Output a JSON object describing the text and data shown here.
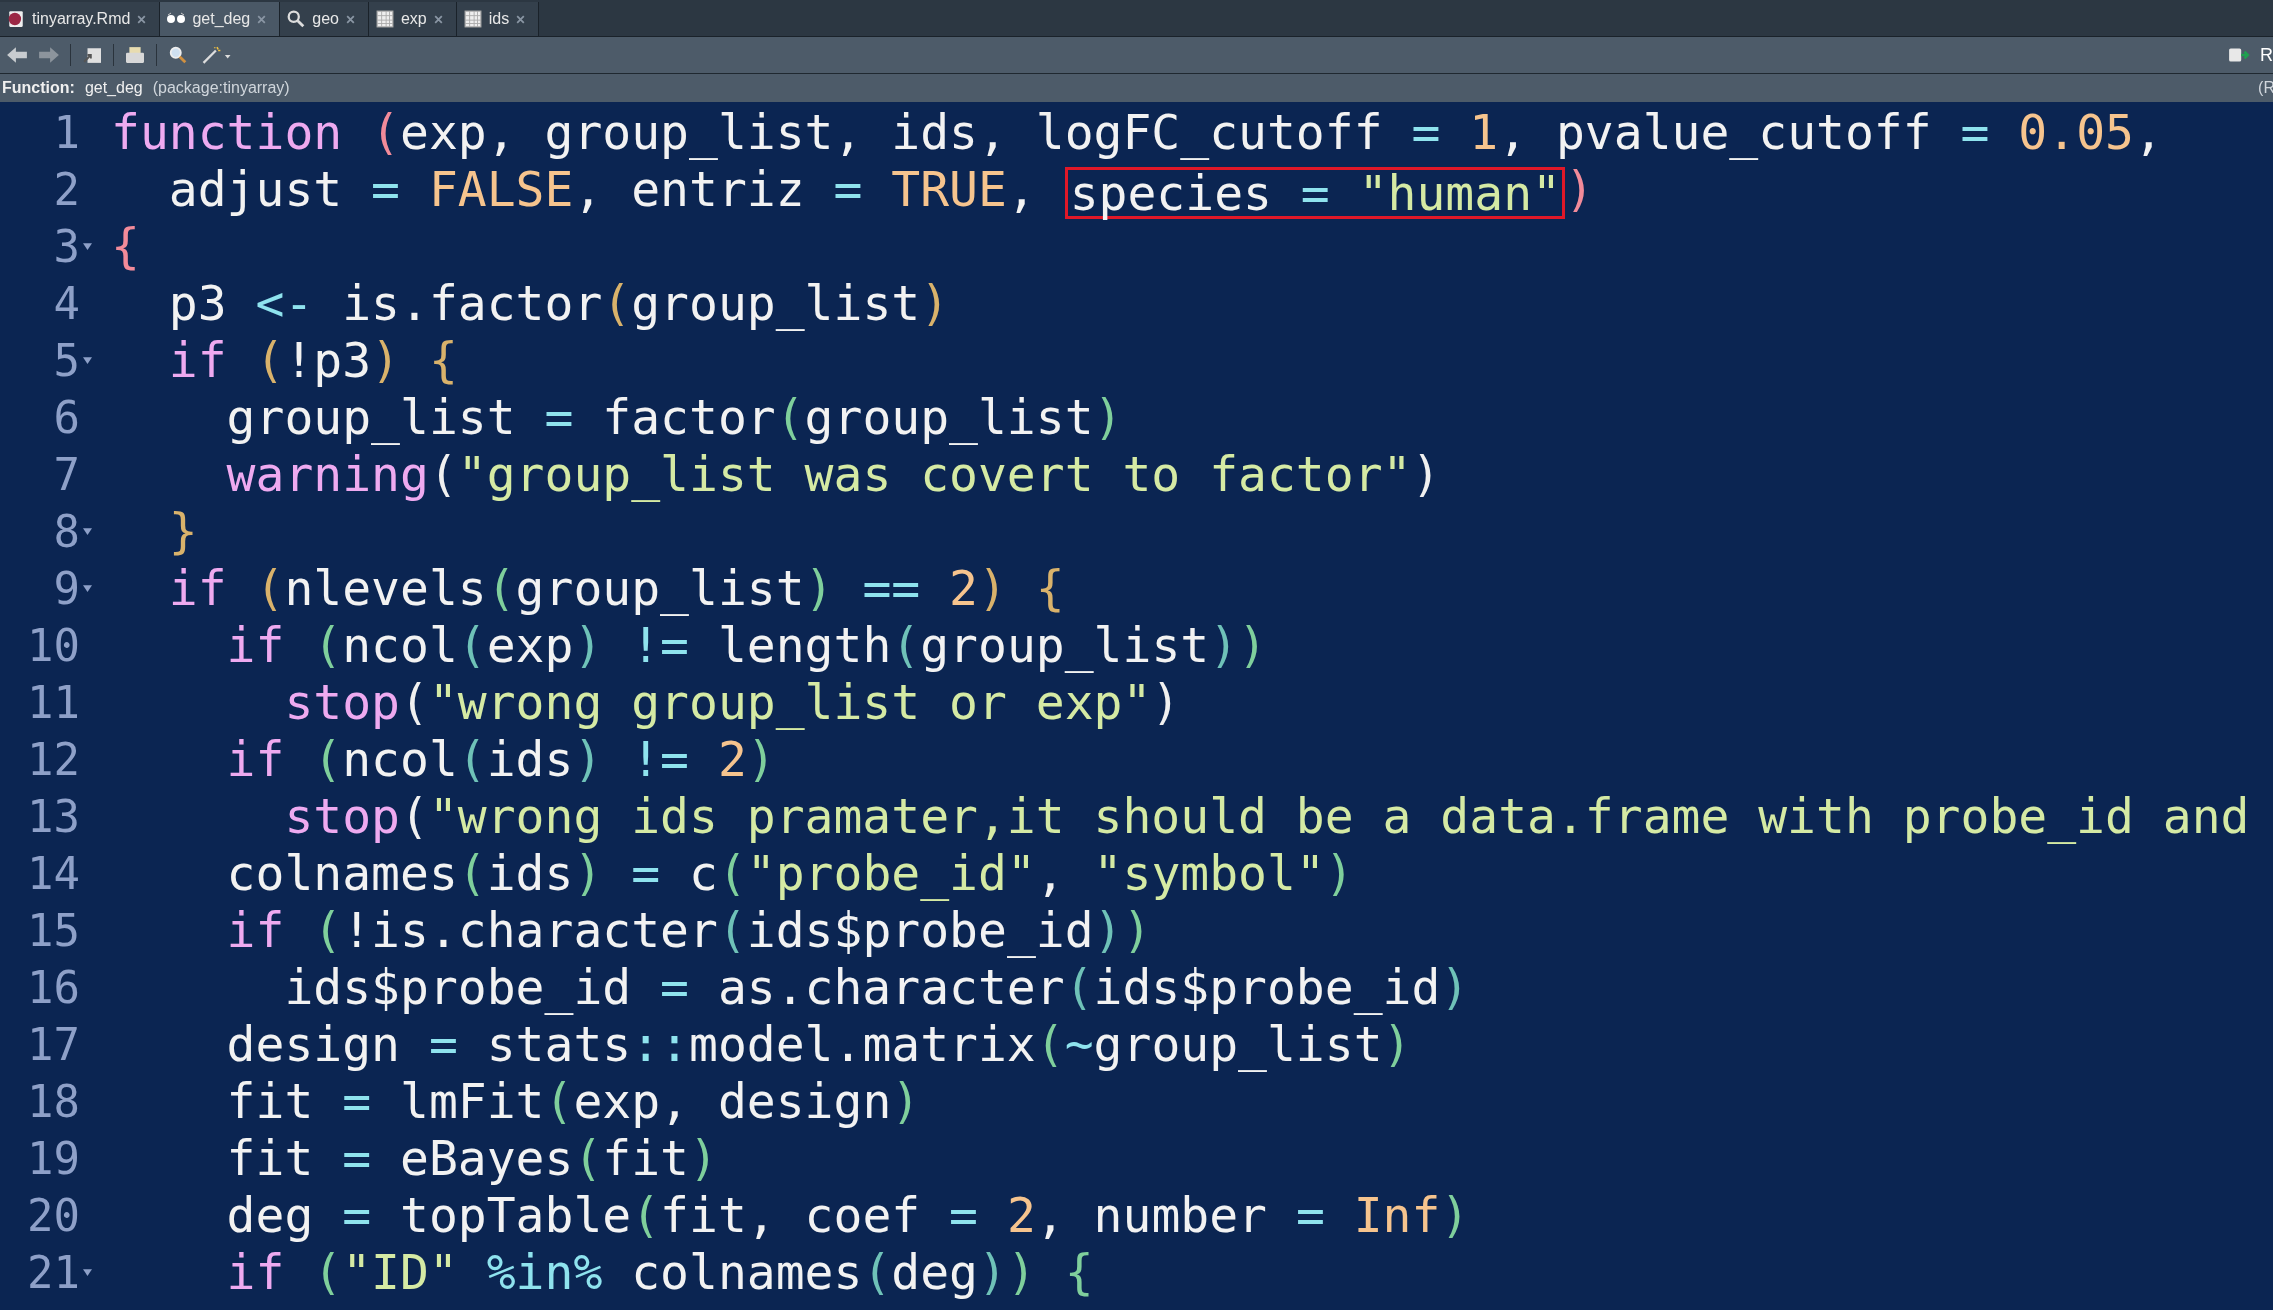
{
  "tabs": [
    {
      "label": "tinyarray.Rmd",
      "kind": "document",
      "selected": false
    },
    {
      "label": "get_deg",
      "kind": "function",
      "selected": true
    },
    {
      "label": "geo",
      "kind": "search",
      "selected": false
    },
    {
      "label": "exp",
      "kind": "table",
      "selected": false
    },
    {
      "label": "ids",
      "kind": "table",
      "selected": false
    }
  ],
  "toolbar": {
    "run_label": "R"
  },
  "function_bar": {
    "label": "Function:",
    "name": "get_deg",
    "package": "(package:tinyarray)",
    "right_text": "(R"
  },
  "lines": [
    {
      "number": "1",
      "fold": false,
      "tokens": [
        {
          "kind": "kw",
          "text": "function "
        },
        {
          "kind": "br",
          "text": "(",
          "color": "#f28b9a"
        },
        {
          "kind": "tx",
          "text": "exp, group_list, ids, logFC_cutoff"
        },
        {
          "kind": "op",
          "text": " = "
        },
        {
          "kind": "nu",
          "text": "1"
        },
        {
          "kind": "tx",
          "text": ", pvalue_cutoff"
        },
        {
          "kind": "op",
          "text": " = "
        },
        {
          "kind": "nu",
          "text": "0.05"
        },
        {
          "kind": "tx",
          "text": ","
        }
      ]
    },
    {
      "number": "2",
      "fold": false,
      "tokens": [
        {
          "kind": "tx",
          "text": "  adjust"
        },
        {
          "kind": "op",
          "text": " = "
        },
        {
          "kind": "nu",
          "text": "FALSE"
        },
        {
          "kind": "tx",
          "text": ", entriz"
        },
        {
          "kind": "op",
          "text": " = "
        },
        {
          "kind": "nu",
          "text": "TRUE"
        },
        {
          "kind": "tx",
          "text": ", "
        },
        {
          "kind": "box",
          "tokens": [
            {
              "kind": "tx",
              "text": "species"
            },
            {
              "kind": "op",
              "text": " = "
            },
            {
              "kind": "st",
              "text": "\"human\""
            }
          ]
        },
        {
          "kind": "br",
          "text": ")",
          "color": "#f28b9a"
        }
      ]
    },
    {
      "number": "3",
      "fold": true,
      "tokens": [
        {
          "kind": "br",
          "text": "{",
          "color": "#f28b9a"
        }
      ]
    },
    {
      "number": "4",
      "fold": false,
      "tokens": [
        {
          "kind": "tx",
          "text": "  p3 "
        },
        {
          "kind": "op",
          "text": "<- "
        },
        {
          "kind": "tx",
          "text": "is.factor"
        },
        {
          "kind": "br",
          "text": "(",
          "color": "#d9b26b"
        },
        {
          "kind": "tx",
          "text": "group_list"
        },
        {
          "kind": "br",
          "text": ")",
          "color": "#d9b26b"
        }
      ]
    },
    {
      "number": "5",
      "fold": true,
      "tokens": [
        {
          "kind": "kw",
          "text": "  if "
        },
        {
          "kind": "br",
          "text": "(",
          "color": "#d9b26b"
        },
        {
          "kind": "tx",
          "text": "!p3"
        },
        {
          "kind": "br",
          "text": ") {",
          "color": "#d9b26b"
        }
      ]
    },
    {
      "number": "6",
      "fold": false,
      "tokens": [
        {
          "kind": "tx",
          "text": "    group_list"
        },
        {
          "kind": "op",
          "text": " = "
        },
        {
          "kind": "tx",
          "text": "factor"
        },
        {
          "kind": "br",
          "text": "(",
          "color": "#7fcf9c"
        },
        {
          "kind": "tx",
          "text": "group_list"
        },
        {
          "kind": "br",
          "text": ")",
          "color": "#7fcf9c"
        }
      ]
    },
    {
      "number": "7",
      "fold": false,
      "tokens": [
        {
          "kind": "kw",
          "text": "    warning"
        },
        {
          "kind": "br",
          "text": "(",
          "color": "#f0f0f0"
        },
        {
          "kind": "st",
          "text": "\"group_list was covert to factor\""
        },
        {
          "kind": "br",
          "text": ")",
          "color": "#f0f0f0"
        }
      ]
    },
    {
      "number": "8",
      "fold": true,
      "tokens": [
        {
          "kind": "br",
          "text": "  }",
          "color": "#d9b26b"
        }
      ]
    },
    {
      "number": "9",
      "fold": true,
      "tokens": [
        {
          "kind": "kw",
          "text": "  if "
        },
        {
          "kind": "br",
          "text": "(",
          "color": "#d9b26b"
        },
        {
          "kind": "tx",
          "text": "nlevels"
        },
        {
          "kind": "br",
          "text": "(",
          "color": "#7fcf9c"
        },
        {
          "kind": "tx",
          "text": "group_list"
        },
        {
          "kind": "br",
          "text": ")",
          "color": "#7fcf9c"
        },
        {
          "kind": "op",
          "text": " == "
        },
        {
          "kind": "nu",
          "text": "2"
        },
        {
          "kind": "br",
          "text": ") {",
          "color": "#d9b26b"
        }
      ]
    },
    {
      "number": "10",
      "fold": false,
      "tokens": [
        {
          "kind": "kw",
          "text": "    if "
        },
        {
          "kind": "br",
          "text": "(",
          "color": "#7fcf9c"
        },
        {
          "kind": "tx",
          "text": "ncol"
        },
        {
          "kind": "br",
          "text": "(",
          "color": "#6fc2b8"
        },
        {
          "kind": "tx",
          "text": "exp"
        },
        {
          "kind": "br",
          "text": ")",
          "color": "#6fc2b8"
        },
        {
          "kind": "op",
          "text": " != "
        },
        {
          "kind": "tx",
          "text": "length"
        },
        {
          "kind": "br",
          "text": "(",
          "color": "#6fc2b8"
        },
        {
          "kind": "tx",
          "text": "group_list"
        },
        {
          "kind": "br",
          "text": ")",
          "color": "#6fc2b8"
        },
        {
          "kind": "br",
          "text": ")",
          "color": "#7fcf9c"
        }
      ]
    },
    {
      "number": "11",
      "fold": false,
      "tokens": [
        {
          "kind": "kw",
          "text": "      stop"
        },
        {
          "kind": "br",
          "text": "(",
          "color": "#f0f0f0"
        },
        {
          "kind": "st",
          "text": "\"wrong group_list or exp\""
        },
        {
          "kind": "br",
          "text": ")",
          "color": "#f0f0f0"
        }
      ]
    },
    {
      "number": "12",
      "fold": false,
      "tokens": [
        {
          "kind": "kw",
          "text": "    if "
        },
        {
          "kind": "br",
          "text": "(",
          "color": "#7fcf9c"
        },
        {
          "kind": "tx",
          "text": "ncol"
        },
        {
          "kind": "br",
          "text": "(",
          "color": "#6fc2b8"
        },
        {
          "kind": "tx",
          "text": "ids"
        },
        {
          "kind": "br",
          "text": ")",
          "color": "#6fc2b8"
        },
        {
          "kind": "op",
          "text": " != "
        },
        {
          "kind": "nu",
          "text": "2"
        },
        {
          "kind": "br",
          "text": ")",
          "color": "#7fcf9c"
        }
      ]
    },
    {
      "number": "13",
      "fold": false,
      "tokens": [
        {
          "kind": "kw",
          "text": "      stop"
        },
        {
          "kind": "br",
          "text": "(",
          "color": "#f0f0f0"
        },
        {
          "kind": "st",
          "text": "\"wrong ids pramater,it should be a data.frame with probe_id and"
        }
      ]
    },
    {
      "number": "14",
      "fold": false,
      "tokens": [
        {
          "kind": "tx",
          "text": "    colnames"
        },
        {
          "kind": "br",
          "text": "(",
          "color": "#7fcf9c"
        },
        {
          "kind": "tx",
          "text": "ids"
        },
        {
          "kind": "br",
          "text": ")",
          "color": "#7fcf9c"
        },
        {
          "kind": "op",
          "text": " = "
        },
        {
          "kind": "tx",
          "text": "c"
        },
        {
          "kind": "br",
          "text": "(",
          "color": "#7fcf9c"
        },
        {
          "kind": "st",
          "text": "\"probe_id\""
        },
        {
          "kind": "tx",
          "text": ", "
        },
        {
          "kind": "st",
          "text": "\"symbol\""
        },
        {
          "kind": "br",
          "text": ")",
          "color": "#7fcf9c"
        }
      ]
    },
    {
      "number": "15",
      "fold": false,
      "tokens": [
        {
          "kind": "kw",
          "text": "    if "
        },
        {
          "kind": "br",
          "text": "(",
          "color": "#7fcf9c"
        },
        {
          "kind": "tx",
          "text": "!is.character"
        },
        {
          "kind": "br",
          "text": "(",
          "color": "#6fc2b8"
        },
        {
          "kind": "tx",
          "text": "ids$probe_id"
        },
        {
          "kind": "br",
          "text": ")",
          "color": "#6fc2b8"
        },
        {
          "kind": "br",
          "text": ")",
          "color": "#7fcf9c"
        }
      ]
    },
    {
      "number": "16",
      "fold": false,
      "tokens": [
        {
          "kind": "tx",
          "text": "      ids$probe_id"
        },
        {
          "kind": "op",
          "text": " = "
        },
        {
          "kind": "tx",
          "text": "as.character"
        },
        {
          "kind": "br",
          "text": "(",
          "color": "#6fc2b8"
        },
        {
          "kind": "tx",
          "text": "ids$probe_id"
        },
        {
          "kind": "br",
          "text": ")",
          "color": "#6fc2b8"
        }
      ]
    },
    {
      "number": "17",
      "fold": false,
      "tokens": [
        {
          "kind": "tx",
          "text": "    design"
        },
        {
          "kind": "op",
          "text": " = "
        },
        {
          "kind": "tx",
          "text": "stats"
        },
        {
          "kind": "op",
          "text": "::"
        },
        {
          "kind": "tx",
          "text": "model.matrix"
        },
        {
          "kind": "br",
          "text": "(",
          "color": "#7fcf9c"
        },
        {
          "kind": "op",
          "text": "~"
        },
        {
          "kind": "tx",
          "text": "group_list"
        },
        {
          "kind": "br",
          "text": ")",
          "color": "#7fcf9c"
        }
      ]
    },
    {
      "number": "18",
      "fold": false,
      "tokens": [
        {
          "kind": "tx",
          "text": "    fit"
        },
        {
          "kind": "op",
          "text": " = "
        },
        {
          "kind": "tx",
          "text": "lmFit"
        },
        {
          "kind": "br",
          "text": "(",
          "color": "#7fcf9c"
        },
        {
          "kind": "tx",
          "text": "exp, design"
        },
        {
          "kind": "br",
          "text": ")",
          "color": "#7fcf9c"
        }
      ]
    },
    {
      "number": "19",
      "fold": false,
      "tokens": [
        {
          "kind": "tx",
          "text": "    fit"
        },
        {
          "kind": "op",
          "text": " = "
        },
        {
          "kind": "tx",
          "text": "eBayes"
        },
        {
          "kind": "br",
          "text": "(",
          "color": "#7fcf9c"
        },
        {
          "kind": "tx",
          "text": "fit"
        },
        {
          "kind": "br",
          "text": ")",
          "color": "#7fcf9c"
        }
      ]
    },
    {
      "number": "20",
      "fold": false,
      "tokens": [
        {
          "kind": "tx",
          "text": "    deg"
        },
        {
          "kind": "op",
          "text": " = "
        },
        {
          "kind": "tx",
          "text": "topTable"
        },
        {
          "kind": "br",
          "text": "(",
          "color": "#7fcf9c"
        },
        {
          "kind": "tx",
          "text": "fit, coef"
        },
        {
          "kind": "op",
          "text": " = "
        },
        {
          "kind": "nu",
          "text": "2"
        },
        {
          "kind": "tx",
          "text": ", number"
        },
        {
          "kind": "op",
          "text": " = "
        },
        {
          "kind": "nu",
          "text": "Inf"
        },
        {
          "kind": "br",
          "text": ")",
          "color": "#7fcf9c"
        }
      ]
    },
    {
      "number": "21",
      "fold": true,
      "tokens": [
        {
          "kind": "kw",
          "text": "    if "
        },
        {
          "kind": "br",
          "text": "(",
          "color": "#7fcf9c"
        },
        {
          "kind": "st",
          "text": "\"ID\""
        },
        {
          "kind": "op",
          "text": " %in% "
        },
        {
          "kind": "tx",
          "text": "colnames"
        },
        {
          "kind": "br",
          "text": "(",
          "color": "#6fc2b8"
        },
        {
          "kind": "tx",
          "text": "deg"
        },
        {
          "kind": "br",
          "text": ")",
          "color": "#6fc2b8"
        },
        {
          "kind": "br",
          "text": ") {",
          "color": "#7fcf9c"
        }
      ]
    }
  ]
}
